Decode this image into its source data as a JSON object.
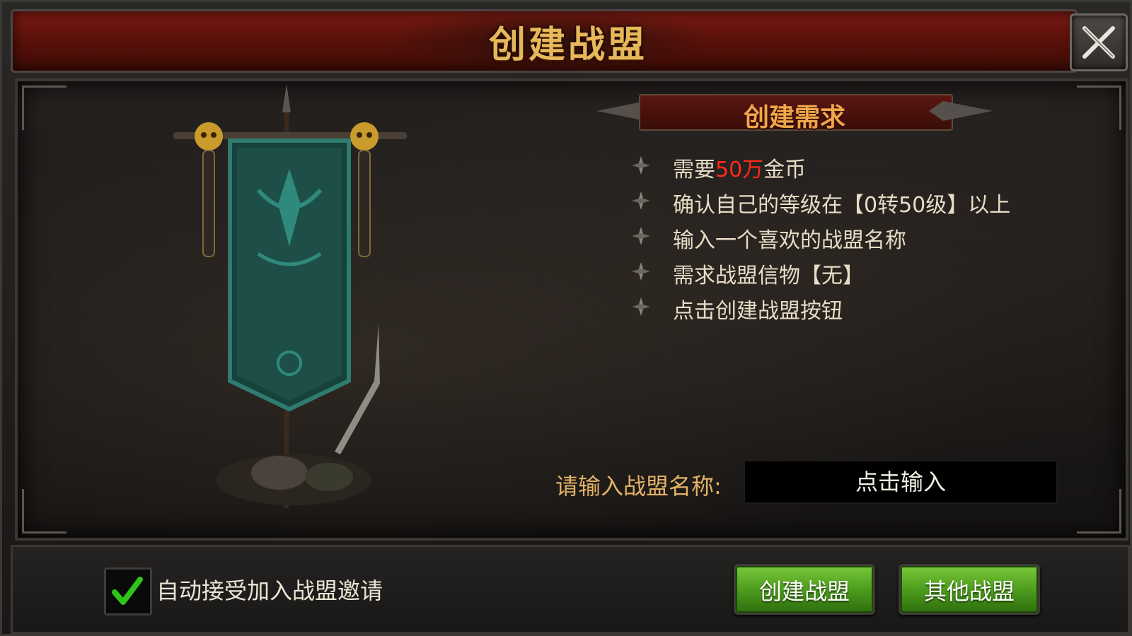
{
  "window": {
    "title": "创建战盟"
  },
  "requirements": {
    "title": "创建需求",
    "items": [
      {
        "pre": "需要",
        "highlight": "50万",
        "post": "金币"
      },
      {
        "pre": "确认自己的等级在【0转50级】以上",
        "highlight": "",
        "post": ""
      },
      {
        "pre": "输入一个喜欢的战盟名称",
        "highlight": "",
        "post": ""
      },
      {
        "pre": "需求战盟信物【无】",
        "highlight": "",
        "post": ""
      },
      {
        "pre": "点击创建战盟按钮",
        "highlight": "",
        "post": ""
      }
    ]
  },
  "name_field": {
    "label": "请输入战盟名称:",
    "placeholder": "点击输入",
    "value": ""
  },
  "auto_accept": {
    "label": "自动接受加入战盟邀请",
    "checked": true
  },
  "buttons": {
    "create": "创建战盟",
    "other": "其他战盟"
  },
  "colors": {
    "highlight": "#ff2a1a",
    "title": "#e7b85a",
    "button_green": "#4d9d1e"
  },
  "icons": {
    "close": "close-icon",
    "bullet": "diamond-bullet-icon",
    "check": "checkmark-icon"
  }
}
